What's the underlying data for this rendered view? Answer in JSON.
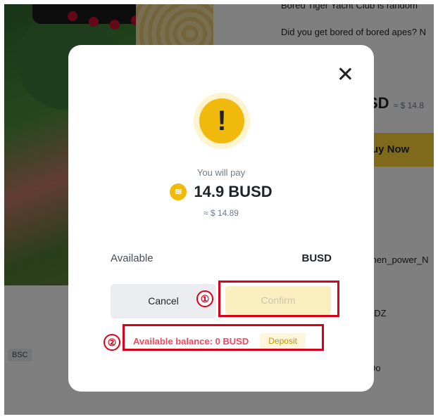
{
  "background": {
    "headline": "Bored Tiger Yacht Club is random",
    "question": "Did you get bored of bored apes? N",
    "price_main": "SD",
    "price_sub": "≈ $ 14.8",
    "buy_label": "uy Now",
    "list_items": [
      "men_power_N",
      "LDZ",
      "Do"
    ],
    "chain_tag": "BSC"
  },
  "modal": {
    "you_will_pay": "You will pay",
    "amount": "14.9 BUSD",
    "usd_approx": "≈ $ 14.89",
    "available_label": "Available",
    "available_value": "BUSD",
    "cancel_label": "Cancel",
    "confirm_label": "Confirm",
    "error_text": "Available balance: 0 BUSD",
    "deposit_label": "Deposit"
  },
  "annotations": {
    "one": "①",
    "two": "②"
  },
  "icons": {
    "warning": "exclamation-icon",
    "close": "close-icon",
    "token": "busd-token-icon"
  },
  "colors": {
    "accent": "#f0b90b",
    "error": "#f6465d",
    "annotation": "#d9001b"
  }
}
